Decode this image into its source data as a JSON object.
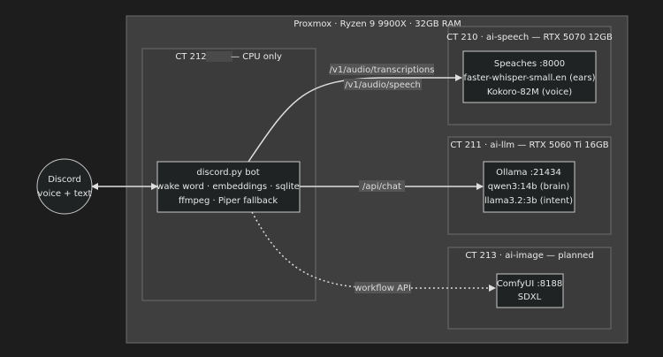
{
  "clusters": {
    "proxmox": {
      "title": "Proxmox  ·  Ryzen 9 9900X · 32GB RAM"
    },
    "ct212": {
      "title_left": "CT 212",
      "title_right": "— CPU only"
    },
    "ct210": {
      "title": "CT 210 · ai-speech — RTX 5070 12GB"
    },
    "ct211": {
      "title": "CT 211 · ai-llm — RTX 5060 Ti 16GB"
    },
    "ct213": {
      "title": "CT 213 · ai-image — planned"
    }
  },
  "nodes": {
    "discord": {
      "lines": [
        "Discord",
        "voice + text"
      ]
    },
    "bot": {
      "lines": [
        "discord.py bot",
        "wake word · embeddings · sqlite",
        "ffmpeg · Piper fallback"
      ]
    },
    "speaches": {
      "lines": [
        "Speaches :8000",
        "faster-whisper-small.en (ears)",
        "Kokoro-82M (voice)"
      ]
    },
    "ollama": {
      "lines": [
        "Ollama :21434",
        "qwen3:14b (brain)",
        "llama3.2:3b (intent)"
      ]
    },
    "comfyui": {
      "lines": [
        "ComfyUI :8188",
        "SDXL"
      ]
    }
  },
  "edges": {
    "transcriptions": "/v1/audio/transcriptions",
    "speech": "/v1/audio/speech",
    "chat": "/api/chat",
    "workflow": "workflow API"
  },
  "colors": {
    "background": "#1d1d1d",
    "cluster_outer_fill": "#3f3f3f",
    "cluster_inner_fill": "#3b3b3b",
    "cluster_stroke": "#6c6c6c",
    "node_fill": "#1f2324",
    "node_stroke": "#c8c8c8",
    "edge": "#dedede",
    "edge_label_bg": "#555555",
    "redaction": "#4a4a4a"
  }
}
